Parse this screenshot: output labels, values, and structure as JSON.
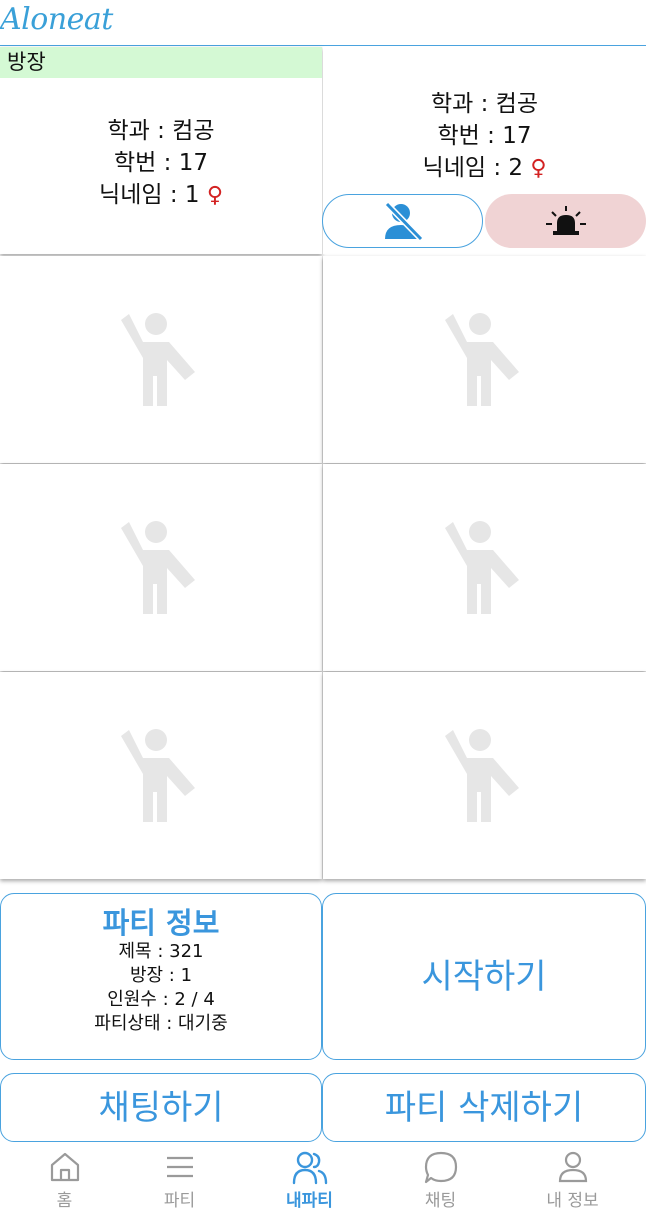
{
  "app": {
    "title": "Aloneat"
  },
  "members": [
    {
      "role": "방장",
      "dept": "학과 : 컴공",
      "year": "학번 : 17",
      "nickname": "닉네임 : 1",
      "gender_icon": "♀"
    },
    {
      "dept": "학과 : 컴공",
      "year": "학번 : 17",
      "nickname": "닉네임 : 2",
      "gender_icon": "♀"
    }
  ],
  "colors": {
    "accent": "#3a96dd",
    "host_badge": "#d4f9d4",
    "report_bg": "#f0d3d4",
    "female": "#d32222",
    "empty_slot_icon": "#e6e6e6"
  },
  "party_info": {
    "title": "파티 정보",
    "name": "제목 : 321",
    "host": "방장 : 1",
    "count": "인원수 : 2 / 4",
    "status": "파티상태 : 대기중"
  },
  "actions": {
    "start": "시작하기",
    "chat": "채팅하기",
    "delete": "파티 삭제하기"
  },
  "nav": {
    "home": "홈",
    "party": "파티",
    "my_party": "내파티",
    "chat": "채팅",
    "my_info": "내 정보",
    "active": "my_party"
  }
}
